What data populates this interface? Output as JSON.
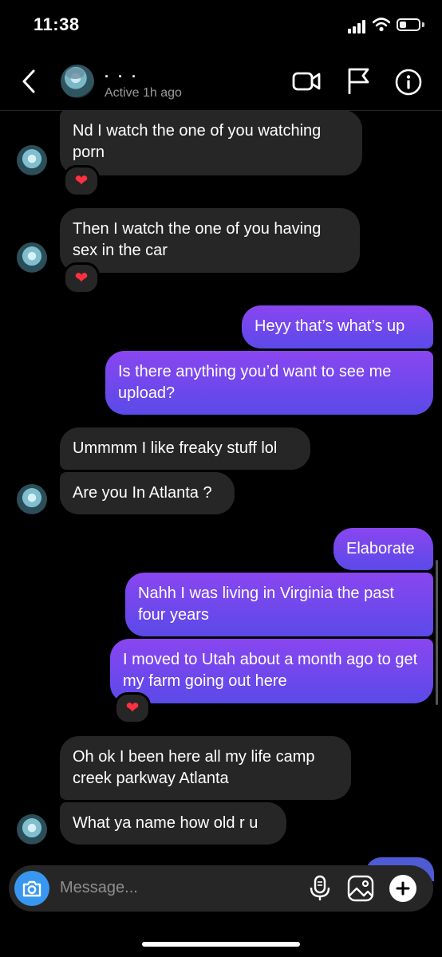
{
  "status_bar": {
    "time": "11:38"
  },
  "header": {
    "username": "· · ·",
    "status": "Active 1h ago"
  },
  "messages": [
    {
      "text": "Nd I watch the one of you watching porn"
    },
    {
      "text": "Then I watch the one of you having sex in the car"
    },
    {
      "text": "Heyy that’s what’s up"
    },
    {
      "text": "Is there anything you’d want to see me upload?"
    },
    {
      "text": "Ummmm I like freaky stuff lol"
    },
    {
      "text": "Are you In Atlanta ?"
    },
    {
      "text": "Elaborate"
    },
    {
      "text": "Nahh I was living in Virginia the past four years"
    },
    {
      "text": "I moved to Utah about a month ago to get my farm going out here"
    },
    {
      "text": "Oh ok I been here all my life camp creek parkway Atlanta"
    },
    {
      "text": "What ya name how old r u"
    }
  ],
  "reaction_emoji": "❤",
  "composer": {
    "placeholder": "Message..."
  },
  "colors": {
    "incoming": "#262626",
    "outgoing_top": "#8a46f0",
    "outgoing_bottom": "#5b4ae8",
    "camera": "#3897f0",
    "heart": "#ff3040"
  }
}
